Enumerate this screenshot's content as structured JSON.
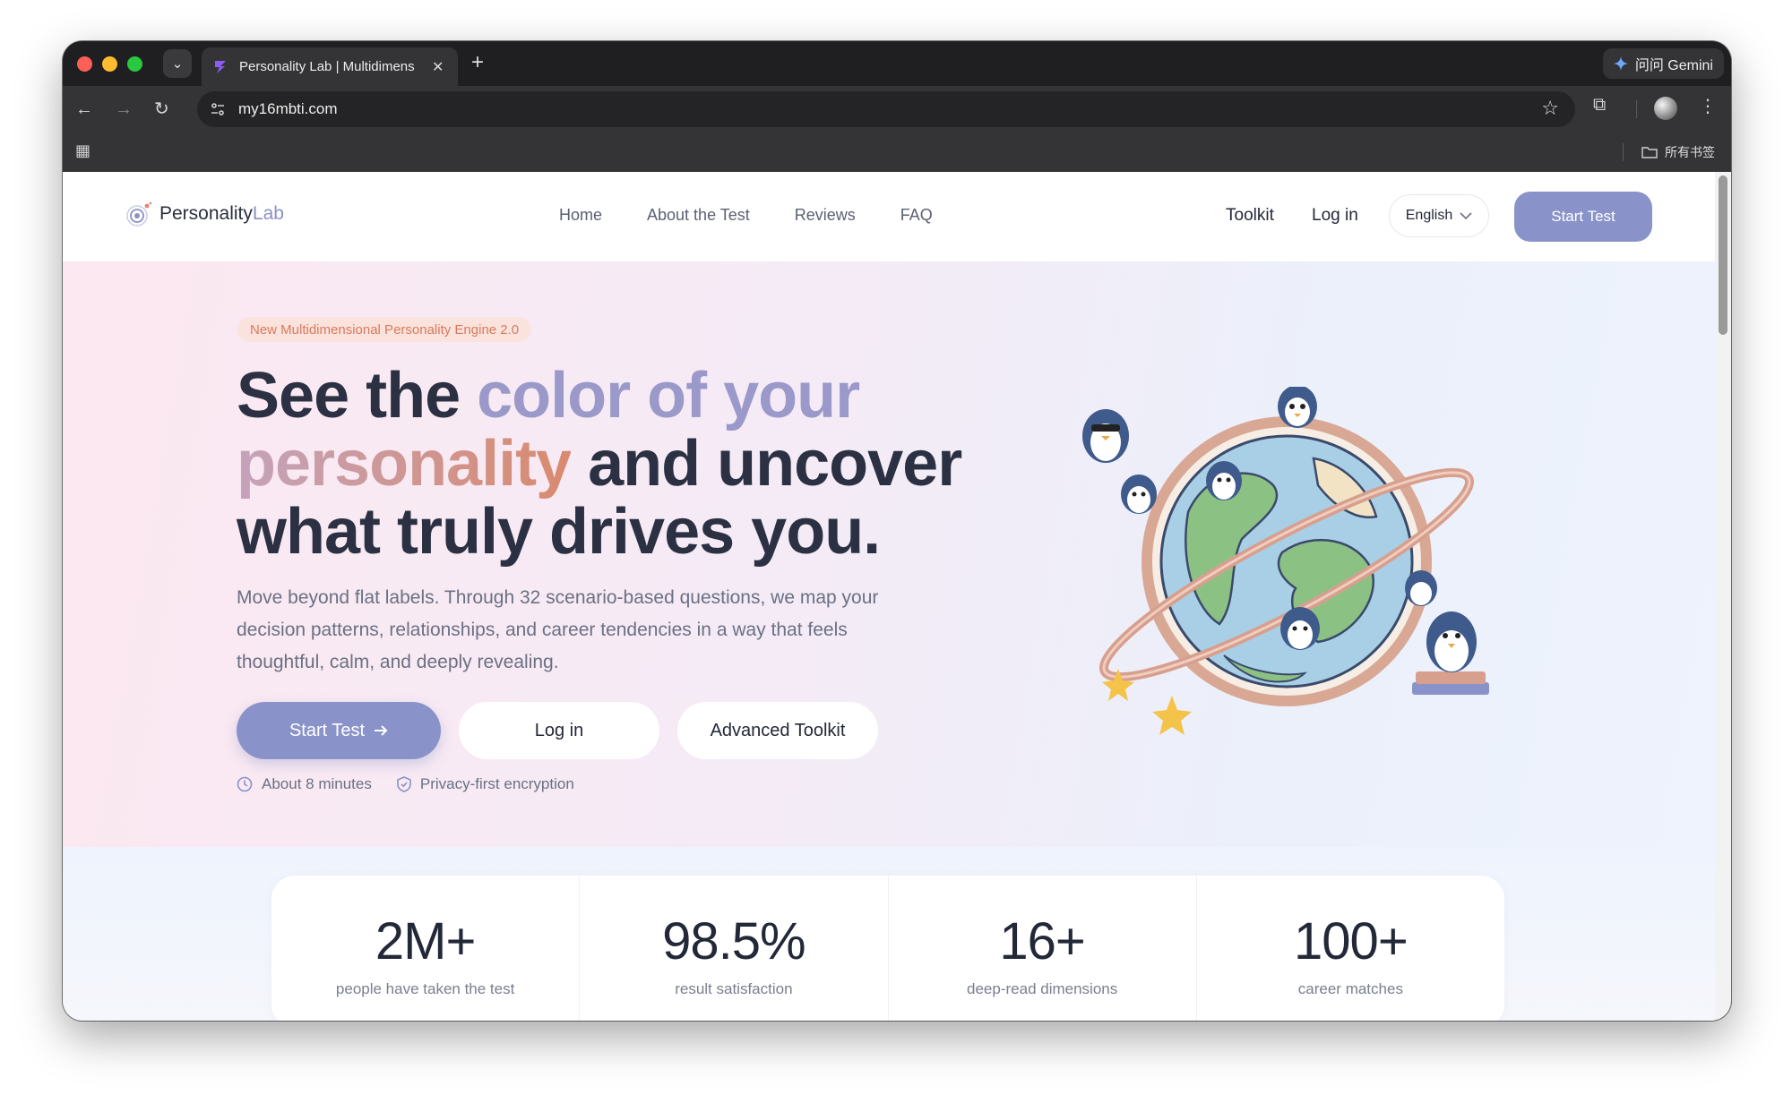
{
  "browser": {
    "tab_title": "Personality Lab | Multidimens",
    "url": "my16mbti.com",
    "gemini_label": "问问 Gemini",
    "bookmarks_all": "所有书签"
  },
  "site": {
    "logo_main": "Personality",
    "logo_accent": "Lab",
    "nav": [
      "Home",
      "About the Test",
      "Reviews",
      "FAQ"
    ],
    "toolkit": "Toolkit",
    "login": "Log in",
    "language": "English",
    "start_test": "Start Test"
  },
  "hero": {
    "badge": "New Multidimensional Personality Engine 2.0",
    "headline_1": "See the ",
    "headline_2": "color of your",
    "headline_3": "personality",
    "headline_4": " and uncover what truly drives you.",
    "subcopy": "Move beyond flat labels. Through 32 scenario-based questions, we map your decision patterns, relationships, and career tendencies in a way that feels thoughtful, calm, and deeply revealing.",
    "cta_primary": "Start Test",
    "cta_login": "Log in",
    "cta_toolkit": "Advanced Toolkit",
    "meta_time": "About 8 minutes",
    "meta_privacy": "Privacy-first encryption"
  },
  "stats": [
    {
      "value": "2M+",
      "label": "people have taken the test"
    },
    {
      "value": "98.5%",
      "label": "result satisfaction"
    },
    {
      "value": "16+",
      "label": "deep-read dimensions"
    },
    {
      "value": "100+",
      "label": "career matches"
    }
  ],
  "colors": {
    "accent": "#8a93c9",
    "badge_text": "#d9795f",
    "headline": "#2b3142"
  }
}
